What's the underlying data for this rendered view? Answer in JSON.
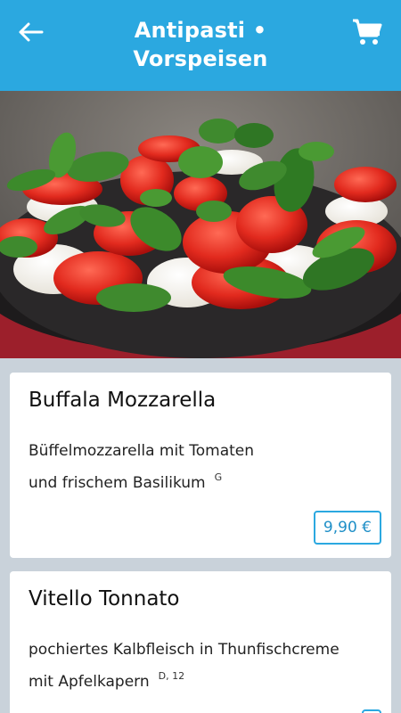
{
  "header": {
    "title_line1": "Antipasti •",
    "title_line2": "Vorspeisen",
    "back_icon": "arrow-left-icon",
    "cart_icon": "shopping-cart-icon"
  },
  "hero": {
    "image": "caprese-salad-photo"
  },
  "items": [
    {
      "name": "Buffala Mozzarella",
      "desc_line1": "Büffelmozzarella mit Tomaten",
      "desc_line2": "und frischem Basilikum",
      "allergens": "G",
      "price": "9,90 €"
    },
    {
      "name": "Vitello Tonnato",
      "desc_line1": "pochiertes Kalbfleisch in Thunfischcreme",
      "desc_line2": "mit Apfelkapern",
      "allergens": "D, 12",
      "price": ""
    }
  ],
  "colors": {
    "accent": "#2ba8e0",
    "background": "#c9d2da",
    "card": "#ffffff"
  }
}
